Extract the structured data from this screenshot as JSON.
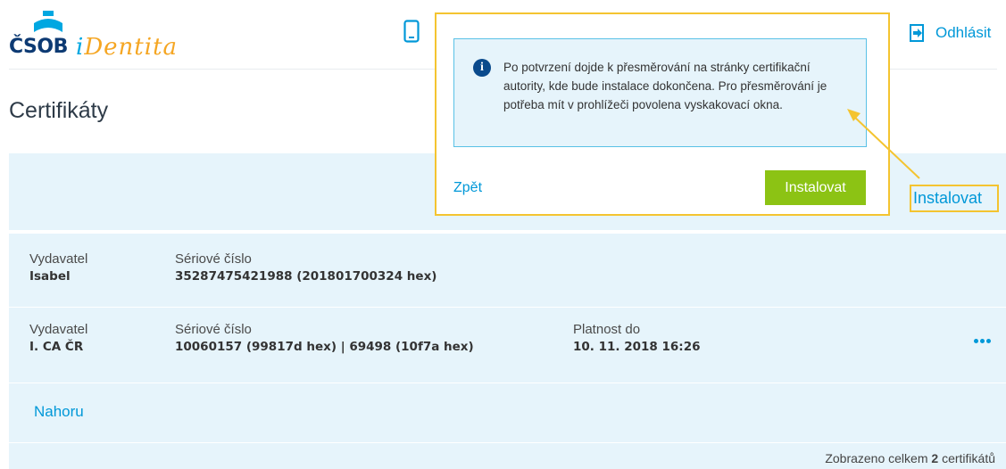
{
  "header": {
    "logo_bank": "ČSOB",
    "logo_product_first": "i",
    "logo_product_rest": "Dentita",
    "logout_label": "Odhlásit"
  },
  "page_title": "Certifikáty",
  "popup": {
    "message": "Po potvrzení dojde k přesměrování na stránky certifikační autority, kde bude instalace dokončena. Pro přesměrování je potřeba mít v prohlížeči povolena vyskakovací okna.",
    "back_label": "Zpět",
    "install_label": "Instalovat"
  },
  "install_link_label": "Instalovat",
  "certificates": [
    {
      "issuer_label": "Vydavatel",
      "issuer": "Isabel",
      "serial_label": "Sériové číslo",
      "serial": "35287475421988 (201801700324 hex)"
    },
    {
      "issuer_label": "Vydavatel",
      "issuer": "I. CA ČR",
      "serial_label": "Sériové číslo",
      "serial": "10060157 (99817d hex) | 69498 (10f7a hex)",
      "valid_label": "Platnost do",
      "valid": "10. 11. 2018 16:26"
    }
  ],
  "top_link_label": "Nahoru",
  "footer": {
    "total_prefix": "Zobrazeno celkem",
    "total_count": "2",
    "total_suffix": "certifikátů"
  },
  "colors": {
    "accent": "#0098d8",
    "highlight": "#f4c430",
    "button": "#8cc314",
    "panel": "#e6f4fb"
  }
}
